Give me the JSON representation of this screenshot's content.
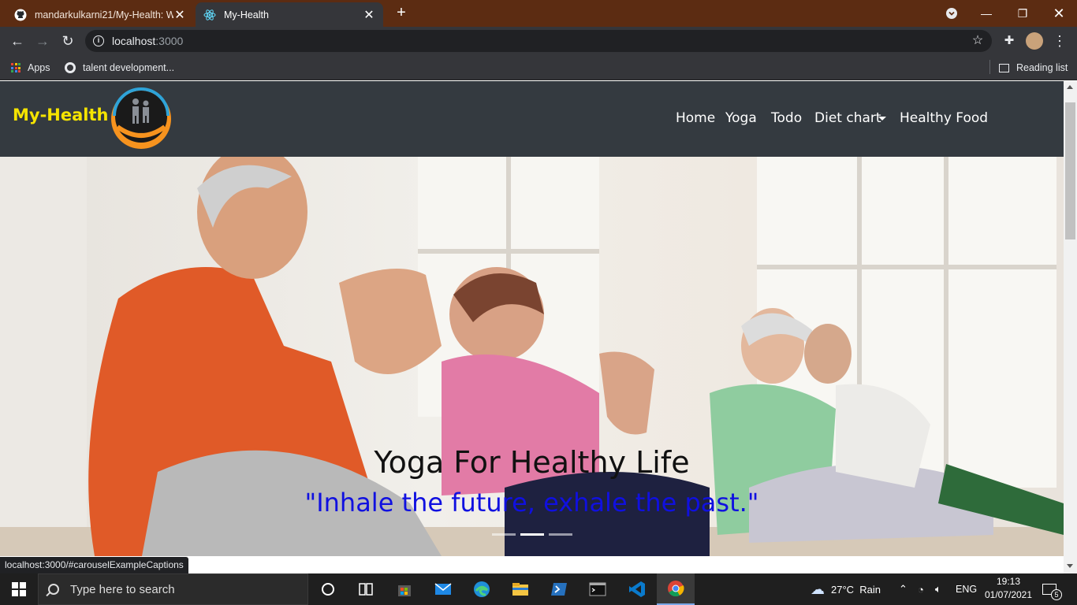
{
  "browser": {
    "tabs": [
      {
        "title": "mandarkulkarni21/My-Health: W",
        "favicon": "github-icon"
      },
      {
        "title": "My-Health",
        "favicon": "react-icon"
      }
    ],
    "address": {
      "host": "localhost",
      "port": ":3000"
    },
    "bookmarks": [
      {
        "label": "Apps",
        "icon": "apps-grid-icon"
      },
      {
        "label": "talent development...",
        "icon": "globe-icon"
      }
    ],
    "reading_list": "Reading list",
    "status_url": "localhost:3000/#carouselExampleCaptions"
  },
  "site": {
    "brand": "My-Health",
    "nav": [
      {
        "label": "Home"
      },
      {
        "label": "Yoga"
      },
      {
        "label": "Todo"
      },
      {
        "label": "Diet chart",
        "dropdown": true
      },
      {
        "label": "Healthy Food"
      }
    ],
    "hero": {
      "title": "Yoga For Healthy Life",
      "quote": "\"Inhale the future, exhale the past.\"",
      "slides": 3,
      "active_slide": 2
    },
    "colors": {
      "brand": "#f5e400",
      "navbar": "#343a40",
      "quote": "#1010e0"
    }
  },
  "taskbar": {
    "search_placeholder": "Type here to search",
    "weather": "27°C  Rain",
    "lang": "ENG",
    "time": "19:13",
    "date": "01/07/2021",
    "notifications": "5"
  }
}
